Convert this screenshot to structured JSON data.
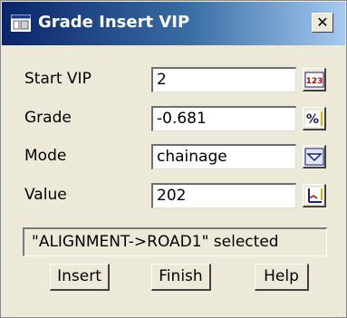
{
  "window": {
    "title": "Grade Insert VIP",
    "close_label": "✕",
    "icon": "app-window-icon"
  },
  "fields": {
    "start_vip": {
      "label": "Start VIP",
      "value": "2",
      "button_icon": "number-123-icon"
    },
    "grade": {
      "label": "Grade",
      "value": "-0.681",
      "button_icon": "percent-icon"
    },
    "mode": {
      "label": "Mode",
      "value": "chainage",
      "button_icon": "chevron-down-icon"
    },
    "value": {
      "label": "Value",
      "value": "202",
      "button_icon": "pick-point-icon"
    }
  },
  "status": "\"ALIGNMENT->ROAD1\" selected",
  "buttons": {
    "insert": "Insert",
    "finish": "Finish",
    "help": "Help"
  },
  "colors": {
    "title_gradient_start": "#0a246a",
    "title_gradient_end": "#a6caf0",
    "dialog_background": "#ece9d8"
  }
}
